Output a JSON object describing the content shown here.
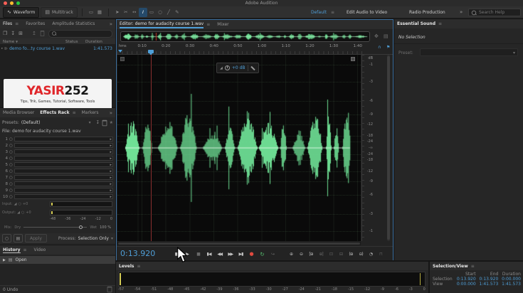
{
  "app": {
    "title": "Adobe Audition"
  },
  "colors": {
    "accent_blue": "#4f9fd8",
    "waveform_green": "#6fe095",
    "record_red": "#e04a3f",
    "loop_green": "#55bd6e",
    "meter_yellow": "#d6cd55",
    "brand_red": "#e0262a",
    "playhead_red": "#8a2f2f"
  },
  "icons": {
    "waveform": "∿",
    "multitrack": "▤",
    "editor_view": "▭",
    "spectral_view": "▦",
    "move_tool": "➤",
    "razor_tool": "✂",
    "slip_tool": "↔",
    "time_selection_tool": "I",
    "marquee_tool": "▭",
    "lasso_tool": "○",
    "paintbrush_tool": "╱",
    "healing_tool": "✎",
    "menu": "≡",
    "chevrons": "»",
    "dropdown": "▾",
    "expand": "▸",
    "folder_open": "❐",
    "import_file": "↧",
    "new_box": "⊞",
    "insert_into": "↥",
    "star": "★",
    "filter": "▼",
    "play": "▶",
    "loop": "↻",
    "power": "○",
    "gain": "◢",
    "snap": "∩",
    "flag": "⚑",
    "overview_move": "✥",
    "overview_menu": "▤",
    "doc": "▤",
    "history_play": "▶",
    "wave_row": "⊪"
  },
  "toolbar": {
    "waveform": "Waveform",
    "multitrack": "Multitrack",
    "workspace": "Default",
    "edit_audio_to_video": "Edit Audio to Video",
    "radio_production": "Radio Production",
    "search_placeholder": "Search Help"
  },
  "files": {
    "tabs": [
      "Files",
      "Favorites",
      "Amplitude Statistics"
    ],
    "columns": [
      "Name",
      "Status",
      "Duration"
    ],
    "file": {
      "name": "demo fo...ty course 1.wav",
      "duration": "1:41.573"
    }
  },
  "logo": {
    "red": "YASIR",
    "dark": "252",
    "tagline": "Tips, Trik, Games, Tutorial, Software, Tools"
  },
  "effects": {
    "tabs": [
      "Media Browser",
      "Effects Rack",
      "Markers"
    ],
    "presets_label": "Presets:",
    "preset": "(Default)",
    "file_line": "File: demo for audacity course 1.wav",
    "slots": [
      "1",
      "2",
      "3",
      "4",
      "5",
      "6",
      "7",
      "8",
      "9",
      "10"
    ],
    "input_label": "Input:",
    "output_label": "Output:",
    "gain_value": "+0",
    "meter_scale": [
      "-48",
      "-36",
      "-24",
      "-12",
      "0"
    ],
    "mix_label": "Mix:",
    "dry": "Dry",
    "wet": "Wet",
    "wet_value": "100 %",
    "apply": "Apply",
    "process_label": "Process:",
    "process_value": "Selection Only"
  },
  "history": {
    "tabs": [
      "History",
      "Video"
    ],
    "items": [
      {
        "label": "Open"
      }
    ],
    "undo": "0 Undo"
  },
  "editor": {
    "tab": "Editor: demo for audacity course 1.wav",
    "mixer_tab": "Mixer",
    "ruler_unit": "hms",
    "ruler_ticks": [
      "0:10",
      "0:20",
      "0:30",
      "0:40",
      "0:50",
      "1:00",
      "1:10",
      "1:20",
      "1:30",
      "1:40"
    ],
    "db_header": "dB",
    "db_scale": [
      "-1",
      "-3",
      "-6",
      "-9",
      "-12",
      "-18",
      "-24",
      "-∞",
      "-24",
      "-18",
      "-12",
      "-9",
      "-6",
      "-3",
      "-1"
    ],
    "hud_gain": "+0 dB",
    "time": "0:13.920"
  },
  "transport": {
    "buttons": [
      {
        "name": "stop",
        "glyph": "■"
      },
      {
        "name": "play",
        "glyph": "▶"
      },
      {
        "name": "pause",
        "glyph": "▮▮"
      },
      {
        "name": "skip-to-start",
        "glyph": "▮◀"
      },
      {
        "name": "rewind",
        "glyph": "◀◀"
      },
      {
        "name": "fast-forward",
        "glyph": "▶▶"
      },
      {
        "name": "skip-to-end",
        "glyph": "▶▮"
      },
      {
        "name": "record",
        "glyph": "●"
      },
      {
        "name": "loop-playback",
        "glyph": "↻"
      },
      {
        "name": "skip-selection",
        "glyph": "↪"
      }
    ],
    "zoom_buttons": [
      {
        "name": "zoom-in-time",
        "glyph": "⊕"
      },
      {
        "name": "zoom-out-time",
        "glyph": "⊖"
      },
      {
        "name": "zoom-in-at-in-point",
        "glyph": "[⊕"
      },
      {
        "name": "zoom-in-at-out-point",
        "glyph": "⊕]"
      },
      {
        "name": "zoom-to-selection",
        "glyph": "⊡"
      },
      {
        "name": "zoom-out-full",
        "glyph": "⊟"
      },
      {
        "name": "zoom-amplitude-in",
        "glyph": "(⊕"
      },
      {
        "name": "zoom-amplitude-out",
        "glyph": "⊖)"
      },
      {
        "name": "playback-timer",
        "glyph": "◔"
      },
      {
        "name": "snap-toggle",
        "glyph": "⊓"
      }
    ]
  },
  "levels": {
    "tab": "Levels",
    "scale": [
      "-57",
      "-54",
      "-51",
      "-48",
      "-45",
      "-42",
      "-39",
      "-36",
      "-33",
      "-30",
      "-27",
      "-24",
      "-21",
      "-18",
      "-15",
      "-12",
      "-9",
      "-6",
      "-3",
      "0"
    ]
  },
  "selection_view": {
    "tab": "Selection/View",
    "columns": [
      "Start",
      "End",
      "Duration"
    ],
    "rows": [
      {
        "label": "Selection",
        "start": "0:13.920",
        "end": "0:13.920",
        "duration": "0:00.000"
      },
      {
        "label": "View",
        "start": "0:00.000",
        "end": "1:41.573",
        "duration": "1:41.573"
      }
    ]
  },
  "essential_sound": {
    "tab": "Essential Sound",
    "no_selection": "No Selection",
    "preset_label": "Preset:"
  }
}
